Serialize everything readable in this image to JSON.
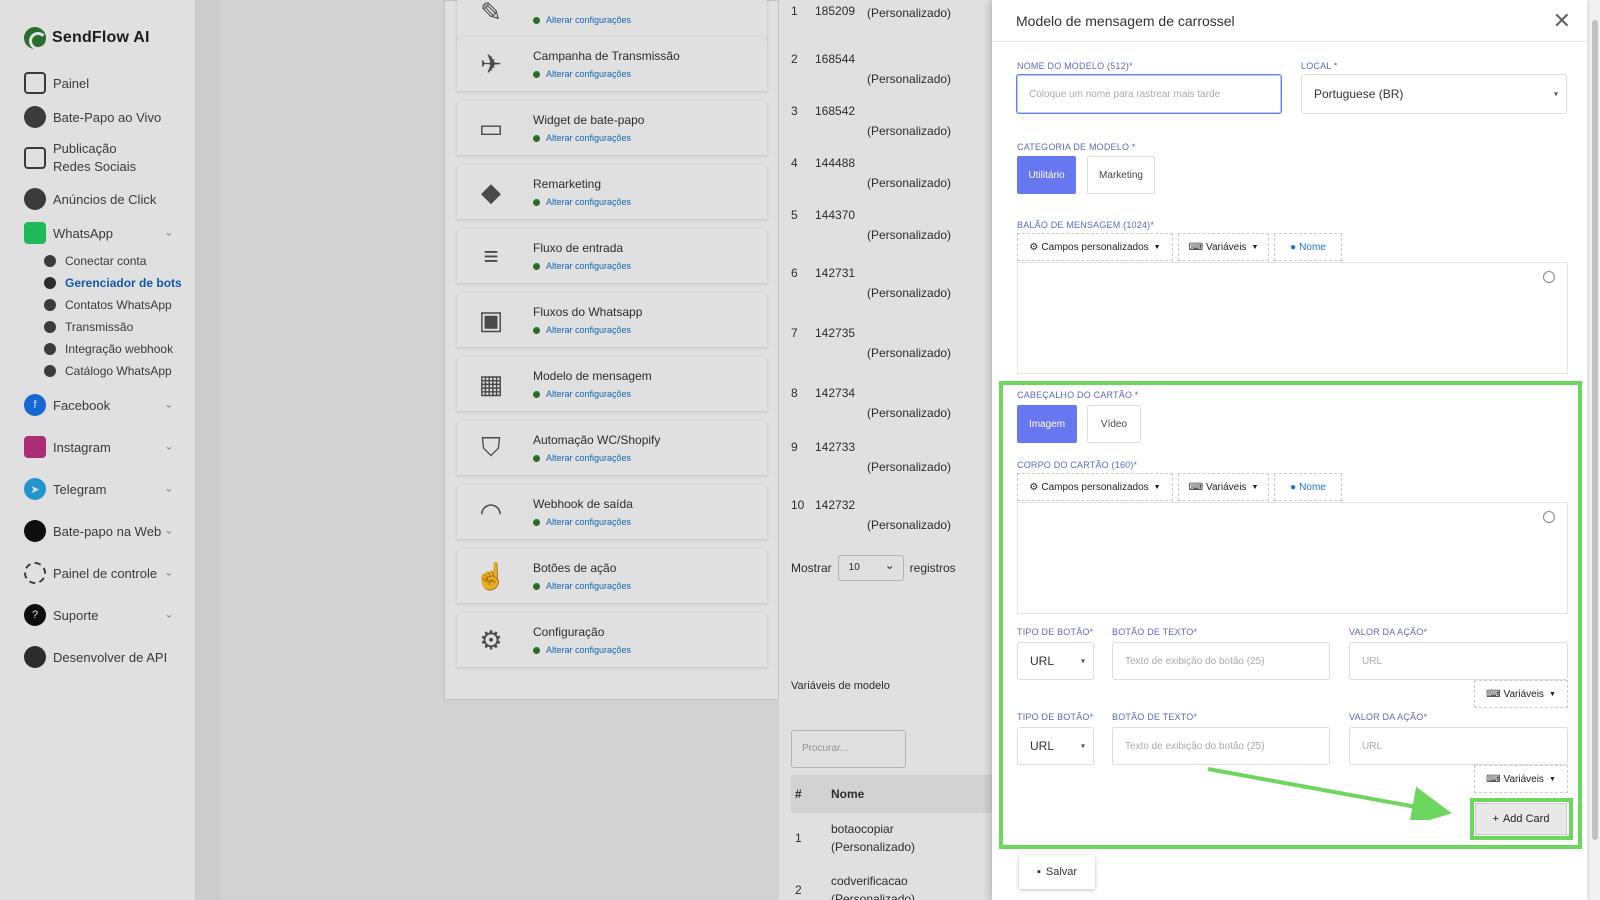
{
  "app": {
    "brand": "SendFlow AI"
  },
  "sidebar": {
    "items": [
      {
        "label": "Painel"
      },
      {
        "label": "Bate-Papo ao Vivo"
      },
      {
        "label": "Publicação Redes Sociais"
      },
      {
        "label": "Anúncios de Click"
      },
      {
        "label": "WhatsApp"
      },
      {
        "label": "Facebook"
      },
      {
        "label": "Instagram"
      },
      {
        "label": "Telegram"
      },
      {
        "label": "Bate-papo na Web"
      },
      {
        "label": "Painel de controle"
      },
      {
        "label": "Suporte"
      },
      {
        "label": "Desenvolver de API"
      }
    ],
    "whatsapp_sub": [
      {
        "label": "Conectar conta"
      },
      {
        "label": "Gerenciador de bots"
      },
      {
        "label": "Contatos WhatsApp"
      },
      {
        "label": "Transmissão"
      },
      {
        "label": "Integração webhook"
      },
      {
        "label": "Catálogo WhatsApp"
      }
    ]
  },
  "ops": {
    "link_label": "Alterar configurações",
    "cards": [
      {
        "title": "Campanha de Transmissão"
      },
      {
        "title": "Widget de bate-papo"
      },
      {
        "title": "Remarketing"
      },
      {
        "title": "Fluxo de entrada"
      },
      {
        "title": "Fluxos do Whatsapp"
      },
      {
        "title": "Modelo de mensagem"
      },
      {
        "title": "Automação WC/Shopify"
      },
      {
        "title": "Webhook de saída"
      },
      {
        "title": "Botões de ação"
      },
      {
        "title": "Configuração"
      }
    ]
  },
  "templates_table": {
    "rows": [
      {
        "n": "1",
        "id": "185209",
        "suffix": "(Personalizado)"
      },
      {
        "n": "2",
        "id": "168544",
        "suffix": "(Personalizado)"
      },
      {
        "n": "3",
        "id": "168542",
        "suffix": "(Personalizado)"
      },
      {
        "n": "4",
        "id": "144488",
        "suffix": "(Personalizado)"
      },
      {
        "n": "5",
        "id": "144370",
        "suffix": "(Personalizado)"
      },
      {
        "n": "6",
        "id": "142731",
        "suffix": "(Personalizado)"
      },
      {
        "n": "7",
        "id": "142735",
        "suffix": "(Personalizado)"
      },
      {
        "n": "8",
        "id": "142734",
        "suffix": "(Personalizado)"
      },
      {
        "n": "9",
        "id": "142733",
        "suffix": "(Personalizado)"
      },
      {
        "n": "10",
        "id": "142732",
        "suffix": "(Personalizado)"
      }
    ],
    "show_label": "Mostrar",
    "show_value": "10",
    "records_label": "registros"
  },
  "variables_panel": {
    "title": "Variáveis de modelo",
    "search_placeholder": "Procurar...",
    "col_hash": "#",
    "col_name": "Nome",
    "rows": [
      {
        "n": "1",
        "name": "botaocopiar",
        "suffix": "(Personalizado)"
      },
      {
        "n": "2",
        "name": "codverificacao",
        "suffix": "(Personalizado)"
      }
    ]
  },
  "modal": {
    "title": "Modelo de mensagem de carrossel",
    "template_name_label": "NOME DO MODELO (512)*",
    "template_name_placeholder": "Coloque um nome para rastrear mais tarde",
    "locale_label": "LOCAL *",
    "locale_value": "Portuguese (BR)",
    "category_label": "CATEGORIA DE MODELO *",
    "category_options": [
      "Utilitário",
      "Marketing"
    ],
    "bubble_label": "BALÃO DE MENSAGEM (1024)*",
    "toolbar": {
      "custom_fields": "Campos personalizados",
      "variables": "Variáveis",
      "name": "Nome"
    },
    "card_header_label": "CABEÇALHO DO CARTÃO *",
    "card_header_options": [
      "Imagem",
      "Vídeo"
    ],
    "card_body_label": "CORPO DO CARTÃO (160)*",
    "button_type_label": "TIPO DE BOTÃO*",
    "button_text_label": "BOTÃO DE TEXTO*",
    "action_value_label": "VALOR DA AÇÃO*",
    "button_type_value": "URL",
    "button_text_placeholder": "Texto de exibição do botão (25)",
    "action_value_placeholder": "URL",
    "variables_btn": "Variáveis",
    "add_card": "Add Card",
    "save": "Salvar"
  },
  "colors": {
    "accent": "#6777ef",
    "highlight": "#6dd65e",
    "link": "#1976d2"
  }
}
